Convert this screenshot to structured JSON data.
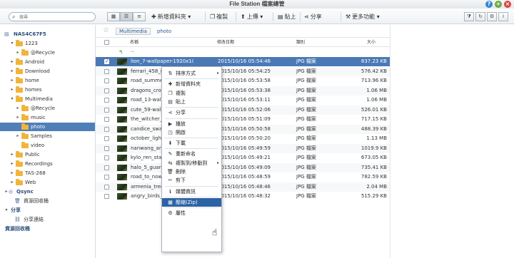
{
  "window": {
    "title": "File Station 檔案總管",
    "help_icon": "?",
    "min_icon": "+",
    "close_icon": "×"
  },
  "toolbar": {
    "search_placeholder": "搜尋",
    "new_folder": "新增資料夾",
    "copy": "複製",
    "upload": "上傳",
    "paste": "貼上",
    "share": "分享",
    "more": "更多功能"
  },
  "sidebar": {
    "items": [
      {
        "label": "NAS4C67F5",
        "kind": "nas"
      },
      {
        "label": "1223"
      },
      {
        "label": "@Recycle"
      },
      {
        "label": "Android"
      },
      {
        "label": "Download"
      },
      {
        "label": "home"
      },
      {
        "label": "homes"
      },
      {
        "label": "Multimedia"
      },
      {
        "label": "@Recycle"
      },
      {
        "label": "music"
      },
      {
        "label": "photo"
      },
      {
        "label": "Samples"
      },
      {
        "label": "video"
      },
      {
        "label": "Public"
      },
      {
        "label": "Recordings"
      },
      {
        "label": "TAS-268"
      },
      {
        "label": "Web"
      },
      {
        "label": "Qsync"
      },
      {
        "label": "資源回收桶"
      },
      {
        "label": "分享"
      },
      {
        "label": "分享連結"
      },
      {
        "label": "資源回收桶"
      }
    ]
  },
  "breadcrumb": {
    "root": "Multimedia",
    "current": "photo"
  },
  "table": {
    "headers": {
      "name": "名稱",
      "modified": "修改日期",
      "type": "類別",
      "size": "大小"
    },
    "up_label": "..",
    "rows": [
      {
        "name": "lion_7-wallpaper-1920x1080.jpg",
        "date": "2015/10/16 05:54:46",
        "type": "JPG 檔案",
        "size": "837.23 KB",
        "selected": true
      },
      {
        "name": "ferrari_458_italia",
        "date": "2015/10/16 05:54:25",
        "type": "JPG 檔案",
        "size": "576.42 KB"
      },
      {
        "name": "road_summer",
        "date": "2015/10/16 05:53:58",
        "type": "JPG 檔案",
        "size": "713.96 KB"
      },
      {
        "name": "dragons_crown",
        "date": "2015/10/16 05:53:38",
        "type": "JPG 檔案",
        "size": "1.06 MB"
      },
      {
        "name": "road_13-wallpaper",
        "date": "2015/10/16 05:53:11",
        "type": "JPG 檔案",
        "size": "1.06 MB"
      },
      {
        "name": "cute_59-wallpaper",
        "date": "2015/10/16 05:52:06",
        "type": "JPG 檔案",
        "size": "526.01 KB"
      },
      {
        "name": "the_witcher_3",
        "date": "2015/10/16 05:51:09",
        "type": "JPG 檔案",
        "size": "717.15 KB"
      },
      {
        "name": "candice_swanepoel",
        "date": "2015/10/16 05:50:58",
        "type": "JPG 檔案",
        "size": "488.39 KB"
      },
      {
        "name": "october_light",
        "date": "2015/10/16 05:50:20",
        "type": "JPG 檔案",
        "size": "1.13 MB"
      },
      {
        "name": "nanwang_art",
        "date": "2015/10/16 05:49:59",
        "type": "JPG 檔案",
        "size": "1019.9 KB"
      },
      {
        "name": "kylo_ren_star_wars",
        "date": "2015/10/16 05:49:21",
        "type": "JPG 檔案",
        "size": "673.05 KB"
      },
      {
        "name": "halo_5_guardians",
        "date": "2015/10/16 05:49:09",
        "type": "JPG 檔案",
        "size": "735.41 KB"
      },
      {
        "name": "road_to_nowhere",
        "date": "2015/10/16 05:48:59",
        "type": "JPG 檔案",
        "size": "782.59 KB"
      },
      {
        "name": "armenia_tree",
        "date": "2015/10/16 05:48:46",
        "type": "JPG 檔案",
        "size": "2.04 MB"
      },
      {
        "name": "angry_birds_2",
        "date": "2015/10/16 05:48:32",
        "type": "JPG 檔案",
        "size": "515.29 KB"
      }
    ]
  },
  "context_menu": {
    "items": [
      {
        "icon": "sort-icon",
        "glyph": "⇅",
        "label": "排序方式",
        "submenu": true
      },
      {
        "sep": true
      },
      {
        "icon": "new-folder-icon",
        "glyph": "✚",
        "label": "新增資料夾"
      },
      {
        "icon": "copy-icon",
        "glyph": "❐",
        "label": "複製"
      },
      {
        "icon": "paste-icon",
        "glyph": "▤",
        "label": "貼上"
      },
      {
        "sep": true
      },
      {
        "icon": "share-icon",
        "glyph": "⋖",
        "label": "分享"
      },
      {
        "sep": true
      },
      {
        "icon": "play-icon",
        "glyph": "▶",
        "label": "播放"
      },
      {
        "icon": "open-icon",
        "glyph": "◳",
        "label": "開啟"
      },
      {
        "sep": true
      },
      {
        "icon": "download-icon",
        "glyph": "⬇",
        "label": "下載"
      },
      {
        "sep": true
      },
      {
        "icon": "rename-icon",
        "glyph": "✎",
        "label": "重新命名"
      },
      {
        "icon": "copy-move-icon",
        "glyph": "⇆",
        "label": "複製到/移動到",
        "submenu": true
      },
      {
        "icon": "delete-icon",
        "glyph": "🗑",
        "label": "刪除"
      },
      {
        "icon": "cut-icon",
        "glyph": "✂",
        "label": "剪下"
      },
      {
        "sep": true
      },
      {
        "icon": "info-icon",
        "glyph": "ℹ",
        "label": "媒體資訊"
      },
      {
        "sep": true
      },
      {
        "icon": "compress-icon",
        "glyph": "▦",
        "label": "壓縮(Zip)",
        "highlighted": true
      },
      {
        "sep": true
      },
      {
        "icon": "properties-icon",
        "glyph": "⚙",
        "label": "屬性"
      }
    ]
  }
}
